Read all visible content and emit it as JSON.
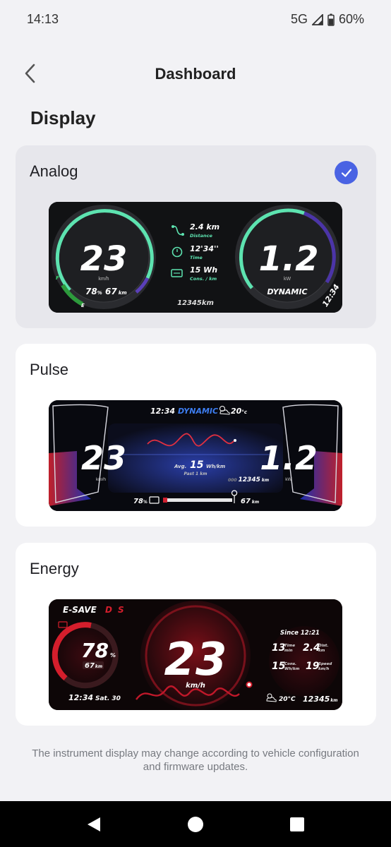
{
  "status_bar": {
    "time": "14:13",
    "network": "5G",
    "battery": "60%"
  },
  "app_bar": {
    "title": "Dashboard"
  },
  "section": {
    "title": "Display"
  },
  "options": {
    "analog": {
      "label": "Analog",
      "selected": true,
      "preview": {
        "speed": "23",
        "speed_unit": "km/h",
        "battery": "78",
        "battery_unit": "%",
        "range": "67",
        "range_unit": "km",
        "fuel_full": "F",
        "fuel_empty": "E",
        "distance": "2.4 km",
        "distance_label": "Distance",
        "time": "12'34''",
        "time_label": "Time",
        "consumption": "15 Wh",
        "consumption_label": "Cons. / km",
        "odometer": "12345km",
        "power": "1.2",
        "power_unit": "kW",
        "mode": "DYNAMIC",
        "clock": "12:34"
      }
    },
    "pulse": {
      "label": "Pulse",
      "selected": false,
      "preview": {
        "clock": "12:34",
        "mode": "DYNAMIC",
        "temp": "20",
        "temp_unit": "°c",
        "speed": "23",
        "speed_unit": "km/h",
        "power": "1.2",
        "power_unit": "kW",
        "avg_label": "Avg.",
        "avg_value": "15",
        "avg_unit": "Wh/km",
        "avg_note": "Past 1 km",
        "odometer_prefix": "000",
        "odometer": "12345",
        "odometer_unit": "km",
        "battery": "78",
        "battery_unit": "%",
        "range": "67",
        "range_unit": "km"
      }
    },
    "energy": {
      "label": "Energy",
      "selected": false,
      "preview": {
        "mode": "E-SAVE",
        "gear_d": "D",
        "gear_s": "S",
        "battery": "78",
        "battery_unit": "%",
        "range": "67",
        "range_unit": "km",
        "clock": "12:34",
        "date": "Sat. 30",
        "speed": "23",
        "speed_unit": "km/h",
        "since": "Since 12:21",
        "trip_time": "13",
        "trip_time_label": "Time",
        "trip_time_unit": "min",
        "trip_dist": "2.4",
        "trip_dist_label": "Dist.",
        "trip_dist_unit": "km",
        "trip_cons": "15",
        "trip_cons_label": "Cons.",
        "trip_cons_unit": "Wh/km",
        "trip_speed": "19",
        "trip_speed_label": "Speed",
        "trip_speed_unit": "km/h",
        "temp": "20°C",
        "odometer": "12345",
        "odometer_unit": "km"
      }
    }
  },
  "disclaimer": "The instrument display may change according to vehicle configuration and firmware updates.",
  "colors": {
    "accent": "#4a63e3",
    "green": "#5de3b0",
    "purple": "#5a3fb8",
    "red": "#e0202e",
    "blue_mode": "#3d7df0"
  }
}
